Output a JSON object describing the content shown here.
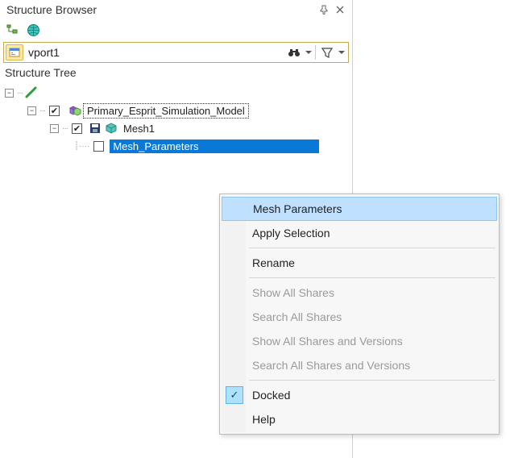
{
  "panel": {
    "title": "Structure Browser",
    "section_label": "Structure Tree"
  },
  "search": {
    "viewport": "vport1"
  },
  "tree": {
    "root": {
      "expanded": true
    },
    "model": {
      "label": "Primary_Esprit_Simulation_Model",
      "checked": true,
      "expanded": true
    },
    "mesh": {
      "label": "Mesh1",
      "checked": true,
      "expanded": true
    },
    "params": {
      "label": "Mesh_Parameters",
      "checked": false,
      "selected": true
    }
  },
  "context_menu": {
    "items": {
      "mesh_parameters": "Mesh Parameters",
      "apply_selection": "Apply Selection",
      "rename": "Rename",
      "show_all_shares": "Show All Shares",
      "search_all_shares": "Search All Shares",
      "show_all_shares_versions": "Show All Shares and Versions",
      "search_all_shares_versions": "Search All Shares and Versions",
      "docked": "Docked",
      "help": "Help"
    },
    "highlighted": "mesh_parameters",
    "checked": "docked"
  }
}
